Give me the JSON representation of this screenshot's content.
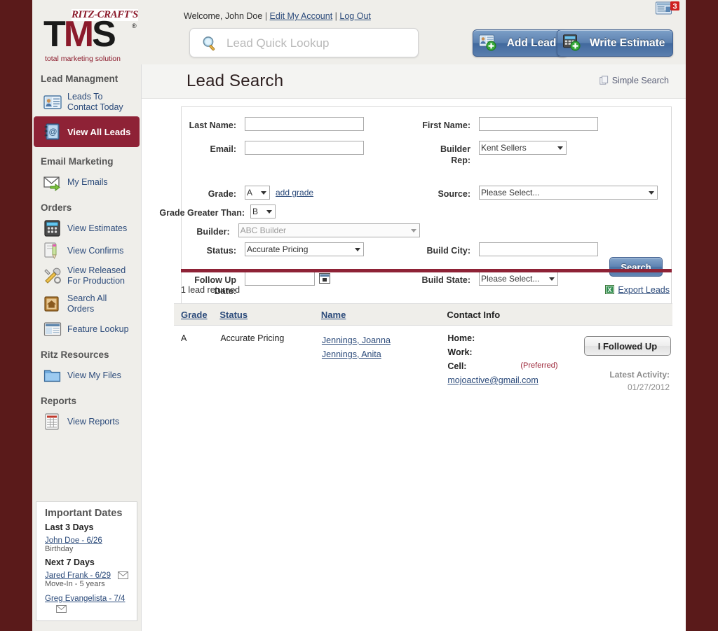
{
  "colors": {
    "frame": "#5a1a1a",
    "accent_maroon": "#8e2236",
    "brand_red": "#8b1a2b",
    "link_blue": "#2b4a7a",
    "page_bg": "#efeeea"
  },
  "logo": {
    "ritz": "RITZ-CRAFT'S",
    "t": "T",
    "m": "M",
    "s": "S",
    "reg": "®",
    "tagline": "total marketing solution"
  },
  "header": {
    "welcome_text": "Welcome, John Doe",
    "sep": "|",
    "edit_account": "Edit My Account",
    "log_out": "Log Out",
    "quick_lookup_placeholder": "Lead Quick Lookup",
    "quick_lookup_value": "",
    "add_lead": "Add Lead",
    "write_estimate": "Write Estimate",
    "notification_count": "3"
  },
  "sidebar": {
    "sections": [
      {
        "heading": "Lead Managment",
        "items": [
          {
            "label": "Leads To Contact Today",
            "icon": "contact-card-icon",
            "active": false
          },
          {
            "label": "View All Leads",
            "icon": "address-book-icon",
            "active": true
          }
        ]
      },
      {
        "heading": "Email Marketing",
        "items": [
          {
            "label": "My Emails",
            "icon": "envelope-arrow-icon",
            "active": false
          }
        ]
      },
      {
        "heading": "Orders",
        "items": [
          {
            "label": "View Estimates",
            "icon": "calculator-icon",
            "active": false
          },
          {
            "label": "View Confirms",
            "icon": "document-pencil-icon",
            "active": false
          },
          {
            "label": "View Released For Production",
            "icon": "tools-icon",
            "active": false
          },
          {
            "label": "Search All Orders",
            "icon": "house-folder-icon",
            "active": false
          },
          {
            "label": "Feature Lookup",
            "icon": "window-icon",
            "active": false
          }
        ]
      },
      {
        "heading": "Ritz Resources",
        "items": [
          {
            "label": "View My Files",
            "icon": "folder-icon",
            "active": false
          }
        ]
      },
      {
        "heading": "Reports",
        "items": [
          {
            "label": "View Reports",
            "icon": "spreadsheet-icon",
            "active": false
          }
        ]
      }
    ]
  },
  "important_dates": {
    "title": "Important Dates",
    "groups": [
      {
        "heading": "Last 3 Days",
        "entries": [
          {
            "link": "John Doe - 6/26",
            "note": "Birthday",
            "has_envelope": false
          }
        ]
      },
      {
        "heading": "Next 7 Days",
        "entries": [
          {
            "link": "Jared Frank - 6/29",
            "note": "Move-In - 5 years",
            "has_envelope": true
          },
          {
            "link": "Greg Evangelista - 7/4",
            "note": "",
            "has_envelope": true
          }
        ]
      }
    ]
  },
  "content": {
    "page_title": "Lead Search",
    "simple_search": "Simple Search"
  },
  "form": {
    "last_name": {
      "label": "Last Name:",
      "value": ""
    },
    "first_name": {
      "label": "First Name:",
      "value": ""
    },
    "email": {
      "label": "Email:",
      "value": ""
    },
    "builder_rep": {
      "label": "Builder Rep:",
      "value": "Kent Sellers"
    },
    "grade": {
      "label": "Grade:",
      "value": "A"
    },
    "add_grade": "add grade",
    "source": {
      "label": "Source:",
      "value": "Please Select..."
    },
    "grade_greater_than": {
      "label": "Grade Greater Than:",
      "value": "B"
    },
    "builder": {
      "label": "Builder:",
      "value": "ABC Builder"
    },
    "status": {
      "label": "Status:",
      "value": "Accurate Pricing"
    },
    "build_city": {
      "label": "Build City:",
      "value": ""
    },
    "follow_up_date": {
      "label": "Follow Up Date:",
      "value": ""
    },
    "build_state": {
      "label": "Build State:",
      "value": "Please Select..."
    },
    "search_button": "Search"
  },
  "results": {
    "count_text": "1 lead returned",
    "export_label": "Export Leads",
    "columns": [
      "Grade",
      "Status",
      "Name",
      "Contact Info"
    ],
    "row": {
      "grade": "A",
      "status": "Accurate Pricing",
      "names": [
        "Jennings, Joanna",
        "Jennings, Anita"
      ],
      "contact": {
        "home_label": "Home:",
        "home_value": "",
        "work_label": "Work:",
        "work_value": "",
        "cell_label": "Cell:",
        "cell_value": "",
        "preferred": "(Preferred)",
        "email": "mojoactive@gmail.com"
      },
      "followed_up_button": "I Followed Up",
      "latest_activity_label": "Latest Activity:",
      "latest_activity_value": "01/27/2012"
    }
  }
}
